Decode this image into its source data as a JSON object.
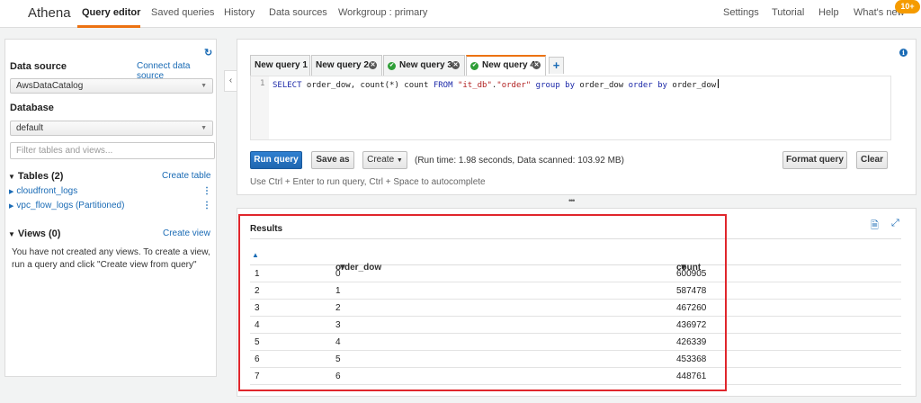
{
  "nav": {
    "brand": "Athena",
    "left_items": [
      "Query editor",
      "Saved queries",
      "History",
      "Data sources",
      "Workgroup : primary"
    ],
    "right_items": [
      "Settings",
      "Tutorial",
      "Help",
      "What's new"
    ],
    "badge": "10+",
    "accent_color": "#ec7211"
  },
  "sidebar": {
    "refresh_icon": "refresh-icon",
    "data_source_label": "Data source",
    "connect_link": "Connect data source",
    "data_source_value": "AwsDataCatalog",
    "database_label": "Database",
    "database_value": "default",
    "filter_placeholder": "Filter tables and views...",
    "tables_header": "Tables (2)",
    "create_table_link": "Create table",
    "tables": [
      "cloudfront_logs",
      "vpc_flow_logs (Partitioned)"
    ],
    "views_header": "Views (0)",
    "create_view_link": "Create view",
    "views_empty_line1": "You have not created any views. To create a view,",
    "views_empty_line2": "run a query and click \"Create view from query\""
  },
  "editor": {
    "tabs": [
      {
        "label": "New query 1",
        "status": "none"
      },
      {
        "label": "New query 2",
        "status": "none"
      },
      {
        "label": "New query 3",
        "status": "success"
      },
      {
        "label": "New query 4",
        "status": "success",
        "active": true
      }
    ],
    "line_number": "1",
    "query": {
      "p1": "SELECT",
      "p2": " order_dow, count(*) count ",
      "p3": "FROM",
      "p4": " ",
      "p5": "\"it_db\"",
      "p6": ".",
      "p7": "\"order\"",
      "p8": " ",
      "p9": "group by",
      "p10": " order_dow ",
      "p11": "order by",
      "p12": " order_dow"
    },
    "run_button": "Run query",
    "save_as_button": "Save as",
    "create_button": "Create",
    "runtime_text": "(Run time: 1.98 seconds, Data scanned: 103.92 MB)",
    "format_button": "Format query",
    "clear_button": "Clear",
    "hint": "Use Ctrl + Enter to run query, Ctrl + Space to autocomplete"
  },
  "results": {
    "title": "Results",
    "columns": [
      "order_dow",
      "count"
    ],
    "rows": [
      [
        "1",
        "0",
        "600905"
      ],
      [
        "2",
        "1",
        "587478"
      ],
      [
        "3",
        "2",
        "467260"
      ],
      [
        "4",
        "3",
        "436972"
      ],
      [
        "5",
        "4",
        "426339"
      ],
      [
        "6",
        "5",
        "453368"
      ],
      [
        "7",
        "6",
        "448761"
      ]
    ],
    "highlight_color": "#e0262c"
  }
}
